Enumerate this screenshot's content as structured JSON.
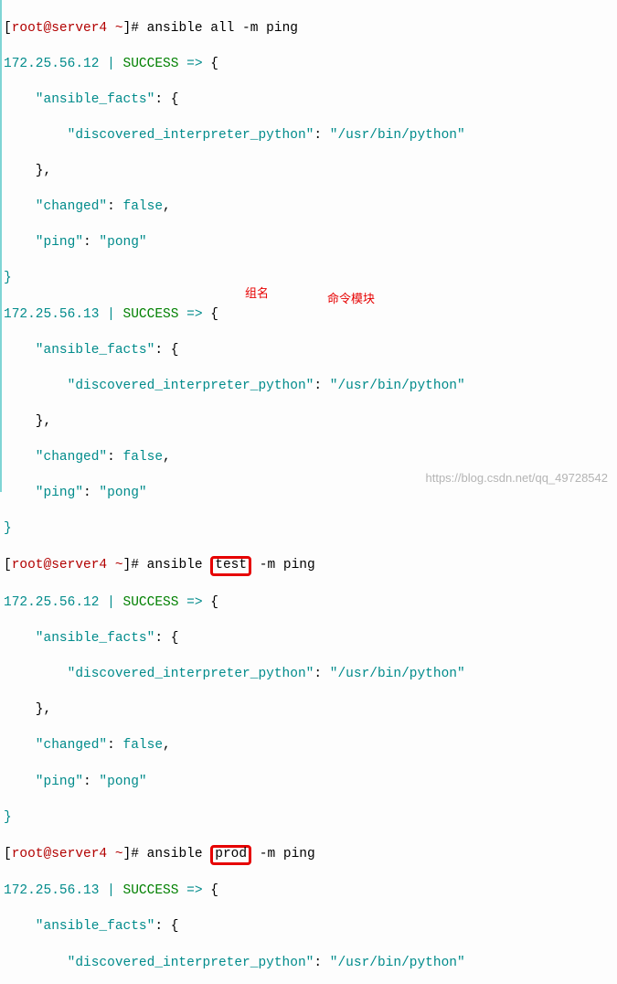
{
  "annotations": {
    "group_name": "组名",
    "cmd_module": "命令模块"
  },
  "watermark": "https://blog.csdn.net/qq_49728542",
  "prompt1": {
    "open": "[",
    "userhost": "root@server4 ~",
    "close": "]#",
    "cmd": "ansible all -m ping"
  },
  "result1": {
    "host": "172.25.56.12",
    "status": " | ",
    "succ": "SUCCESS",
    "arrow": " => ",
    "brace": "{",
    "facts_key": "    \"ansible_facts\"",
    "facts_sep": ": {",
    "disc_key": "        \"discovered_interpreter_python\"",
    "disc_sep": ": ",
    "disc_val": "\"/usr/bin/python\"",
    "close_in": "    },",
    "changed_key": "    \"changed\"",
    "changed_sep": ": ",
    "changed_val": "false",
    "changed_comma": ",",
    "ping_key": "    \"ping\"",
    "ping_sep": ": ",
    "ping_val": "\"pong\"",
    "close_out": "}"
  },
  "result2": {
    "host": "172.25.56.13",
    "status": " | ",
    "succ": "SUCCESS",
    "arrow": " => ",
    "brace": "{",
    "facts_key": "    \"ansible_facts\"",
    "facts_sep": ": {",
    "disc_key": "        \"discovered_interpreter_python\"",
    "disc_sep": ": ",
    "disc_val": "\"/usr/bin/python\"",
    "close_in": "    },",
    "changed_key": "    \"changed\"",
    "changed_sep": ": ",
    "changed_val": "false",
    "changed_comma": ",",
    "ping_key": "    \"ping\"",
    "ping_sep": ": ",
    "ping_val": "\"pong\"",
    "close_out": "}"
  },
  "prompt2": {
    "open": "[",
    "userhost": "root@server4 ~",
    "close": "]#",
    "cmd_pre": "ansible ",
    "group": "test",
    "cmd_post": " -m ping"
  },
  "result3": {
    "host": "172.25.56.12",
    "status": " | ",
    "succ": "SUCCESS",
    "arrow": " => ",
    "brace": "{",
    "facts_key": "    \"ansible_facts\"",
    "facts_sep": ": {",
    "disc_key": "        \"discovered_interpreter_python\"",
    "disc_sep": ": ",
    "disc_val": "\"/usr/bin/python\"",
    "close_in": "    },",
    "changed_key": "    \"changed\"",
    "changed_sep": ": ",
    "changed_val": "false",
    "changed_comma": ",",
    "ping_key": "    \"ping\"",
    "ping_sep": ": ",
    "ping_val": "\"pong\"",
    "close_out": "}"
  },
  "prompt3": {
    "open": "[",
    "userhost": "root@server4 ~",
    "close": "]#",
    "cmd_pre": "ansible ",
    "group": "prod",
    "cmd_post": " -m ping"
  },
  "result4": {
    "host": "172.25.56.13",
    "status": " | ",
    "succ": "SUCCESS",
    "arrow": " => ",
    "brace": "{",
    "facts_key": "    \"ansible_facts\"",
    "facts_sep": ": {",
    "disc_key": "        \"discovered_interpreter_python\"",
    "disc_sep": ": ",
    "disc_val": "\"/usr/bin/python\""
  }
}
